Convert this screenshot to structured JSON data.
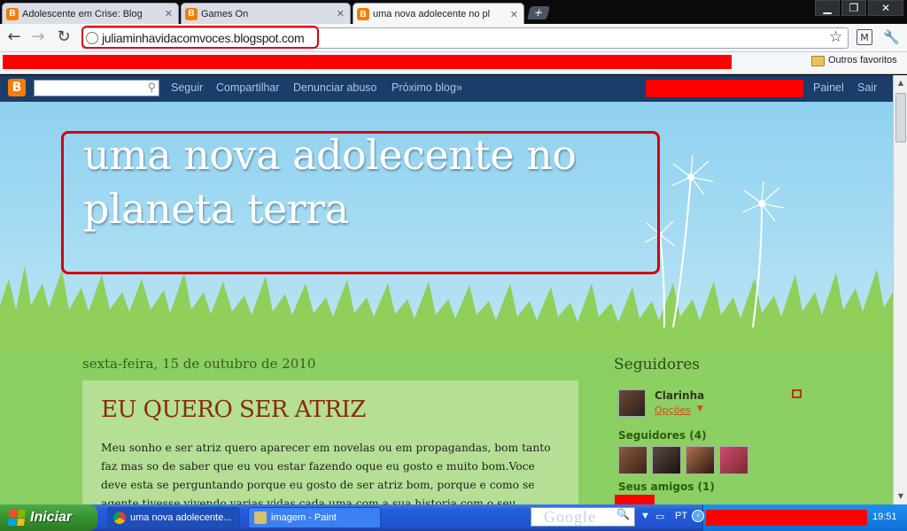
{
  "browser": {
    "tabs": [
      {
        "label": "Adolescente em Crise: Blog",
        "favicon": "B"
      },
      {
        "label": "Games On",
        "favicon": "B"
      },
      {
        "label": "uma nova adolecente no pl",
        "favicon": "B"
      }
    ],
    "new_tab": "+",
    "url": "juliaminhavidacomvoces.blogspot.com",
    "bookmarks_other": "Outros favoritos"
  },
  "navbar": {
    "logo": "B",
    "links": [
      "Seguir",
      "Compartilhar",
      "Denunciar abuso",
      "Próximo blog»"
    ],
    "right_links": [
      "Painel",
      "Sair"
    ]
  },
  "header": {
    "title_line1": "uma nova adolecente no",
    "title_line2": "planeta terra"
  },
  "post": {
    "date": "sexta-feira, 15 de outubro de 2010",
    "title": "EU QUERO SER ATRIZ",
    "body": "Meu sonho e ser atriz quero aparecer em novelas ou em propagandas, bom tanto faz mas so de saber que eu vou  estar fazendo oque eu gosto e muito bom.Voce deve esta se perguntando porque eu gosto de ser atriz bom, porque e como se agente tivesse vivendo varias vidas cada uma com a sua historia com o seu personagem"
  },
  "sidebar": {
    "title": "Seguidores",
    "member_name": "Clarinha",
    "options": "Opções",
    "followers_label": "Seguidores (4)",
    "friends_label": "Seus amigos (1)"
  },
  "taskbar": {
    "start": "Iniciar",
    "tasks": [
      "uma nova adolecente...",
      "imagem - Paint"
    ],
    "google": "Google",
    "lang": "PT",
    "clock": "19:51"
  },
  "colors": {
    "navbar": "#1b3d6a",
    "post_title": "#8a2a10",
    "highlight_red": "#ff0000"
  }
}
